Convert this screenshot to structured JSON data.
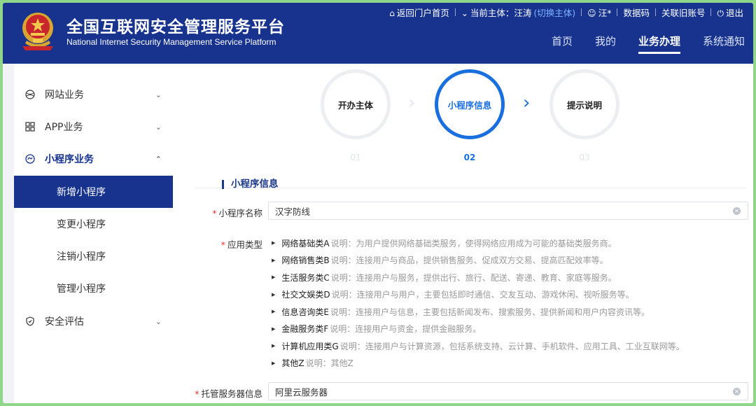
{
  "header": {
    "title_cn": "全国互联网安全管理服务平台",
    "title_en": "National Internet Security Management Service Platform",
    "topbar": {
      "back_portal": "返回门户首页",
      "current_subject_label": "当前主体：汪涛",
      "switch_subject": "(切换主体)",
      "user": "汪*",
      "data_code": "数据码",
      "link_old_account": "关联旧账号",
      "logout": "退出"
    },
    "nav": [
      {
        "label": "首页",
        "active": false
      },
      {
        "label": "我的",
        "active": false
      },
      {
        "label": "业务办理",
        "active": true
      },
      {
        "label": "系统通知",
        "active": false
      }
    ]
  },
  "sidebar": {
    "items": [
      {
        "label": "网站业务",
        "icon": "globe-icon"
      },
      {
        "label": "APP业务",
        "icon": "apps-grid-icon"
      },
      {
        "label": "小程序业务",
        "icon": "mini-program-icon",
        "open": true
      },
      {
        "label": "安全评估",
        "icon": "shield-icon"
      }
    ],
    "subitems": [
      {
        "label": "新增小程序",
        "active": true
      },
      {
        "label": "变更小程序",
        "active": false
      },
      {
        "label": "注销小程序",
        "active": false
      },
      {
        "label": "管理小程序",
        "active": false
      }
    ]
  },
  "steps": [
    {
      "label": "开办主体",
      "num": "01",
      "state": "done"
    },
    {
      "label": "小程序信息",
      "num": "02",
      "state": "current"
    },
    {
      "label": "提示说明",
      "num": "03",
      "state": "next"
    }
  ],
  "form": {
    "section_title": "小程序信息",
    "name_label": "小程序名称",
    "name_value": "汉字防线",
    "type_label": "应用类型",
    "types": [
      {
        "name": "网络基础类A",
        "desc": "说明：为用户提供网络基础类服务，使得网络应用成为可能的基础类服务商。"
      },
      {
        "name": "网络销售类B",
        "desc": "说明：连接用户与商品，提供销售服务、促成双方交易、提高匹配效率等。"
      },
      {
        "name": "生活服务类C",
        "desc": "说明：连接用户与服务，提供出行、旅行、配送、寄递、教育、家庭等服务。"
      },
      {
        "name": "社交文娱类D",
        "desc": "说明：连接用户与用户，主要包括即时通信、交友互动、游戏休闲、视听服务等。"
      },
      {
        "name": "信息咨询类E",
        "desc": "说明：连接用户与信息，主要包括新闻发布、搜索服务、提供新闻和用户内容资讯等。"
      },
      {
        "name": "金融服务类F",
        "desc": "说明：连接用户与资金，提供金融服务。"
      },
      {
        "name": "计算机应用类G",
        "desc": "说明：连接用户与计算资源，包括系统支持、云计算、手机软件、应用工具、工业互联网等。"
      },
      {
        "name": "其他Z",
        "desc": "说明：其他Z"
      }
    ],
    "server_label": "托管服务器信息",
    "server_value": "阿里云服务器"
  }
}
